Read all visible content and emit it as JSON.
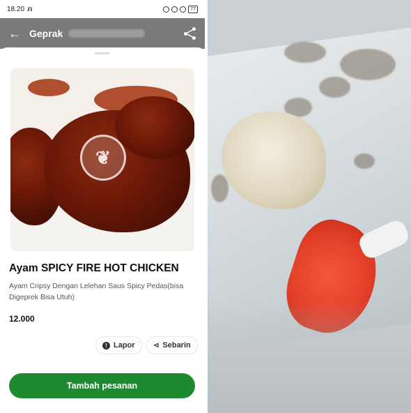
{
  "status_bar": {
    "time": "18.20",
    "signal": ".ıl\"ıl",
    "battery": "77"
  },
  "app_bar": {
    "title": "Geprak"
  },
  "product": {
    "title": "Ayam SPICY FIRE HOT CHICKEN",
    "description": "Ayam Cripsy Dengan Lelehan Saus Spicy Pedas(bisa Digeprek Bisa Utuh)",
    "price": "12.000"
  },
  "actions": {
    "report_label": "Lapor",
    "share_label": "Sebarin"
  },
  "order_button_label": "Tambah pesanan",
  "colors": {
    "accent_green": "#1d8a2f",
    "app_bar_gray": "#7a7a7a"
  },
  "icons": {
    "back": "arrow-left-icon",
    "share": "share-icon",
    "report": "alert-icon",
    "watermark": "restaurant-logo-icon"
  }
}
